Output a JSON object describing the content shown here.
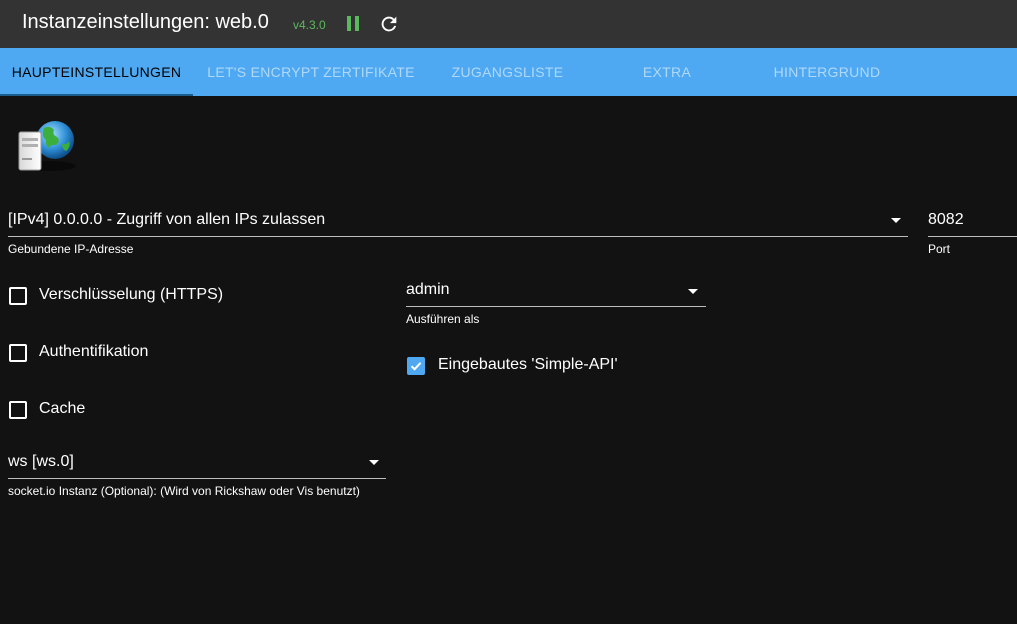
{
  "header": {
    "title": "Instanzeinstellungen: web.0",
    "version": "v4.3.0",
    "pause_icon": "pause-icon",
    "reload_icon": "reload-icon",
    "colors": {
      "bar": "#333333",
      "version": "#5cb85c"
    }
  },
  "tabs": [
    {
      "label": "HAUPTEINSTELLUNGEN",
      "active": true
    },
    {
      "label": "LET'S ENCRYPT ZERTIFIKATE",
      "active": false
    },
    {
      "label": "ZUGANGSLISTE",
      "active": false
    },
    {
      "label": "EXTRA",
      "active": false
    },
    {
      "label": "HINTERGRUND",
      "active": false
    }
  ],
  "tab_bar_color": "#4ea9f2",
  "logo": {
    "icon": "web-server-globe-icon"
  },
  "form": {
    "bind_ip": {
      "value": "[IPv4] 0.0.0.0 - Zugriff von allen IPs zulassen",
      "label": "Gebundene IP-Adresse"
    },
    "port": {
      "value": "8082",
      "label": "Port"
    },
    "https": {
      "label": "Verschlüsselung (HTTPS)",
      "checked": false
    },
    "auth": {
      "label": "Authentifikation",
      "checked": false
    },
    "cache": {
      "label": "Cache",
      "checked": false
    },
    "run_as": {
      "value": "admin",
      "label": "Ausführen als"
    },
    "simple_api": {
      "label": "Eingebautes 'Simple-API'",
      "checked": true
    },
    "socket_io": {
      "value": "ws [ws.0]",
      "label": "socket.io Instanz (Optional): (Wird von Rickshaw oder Vis benutzt)"
    }
  }
}
